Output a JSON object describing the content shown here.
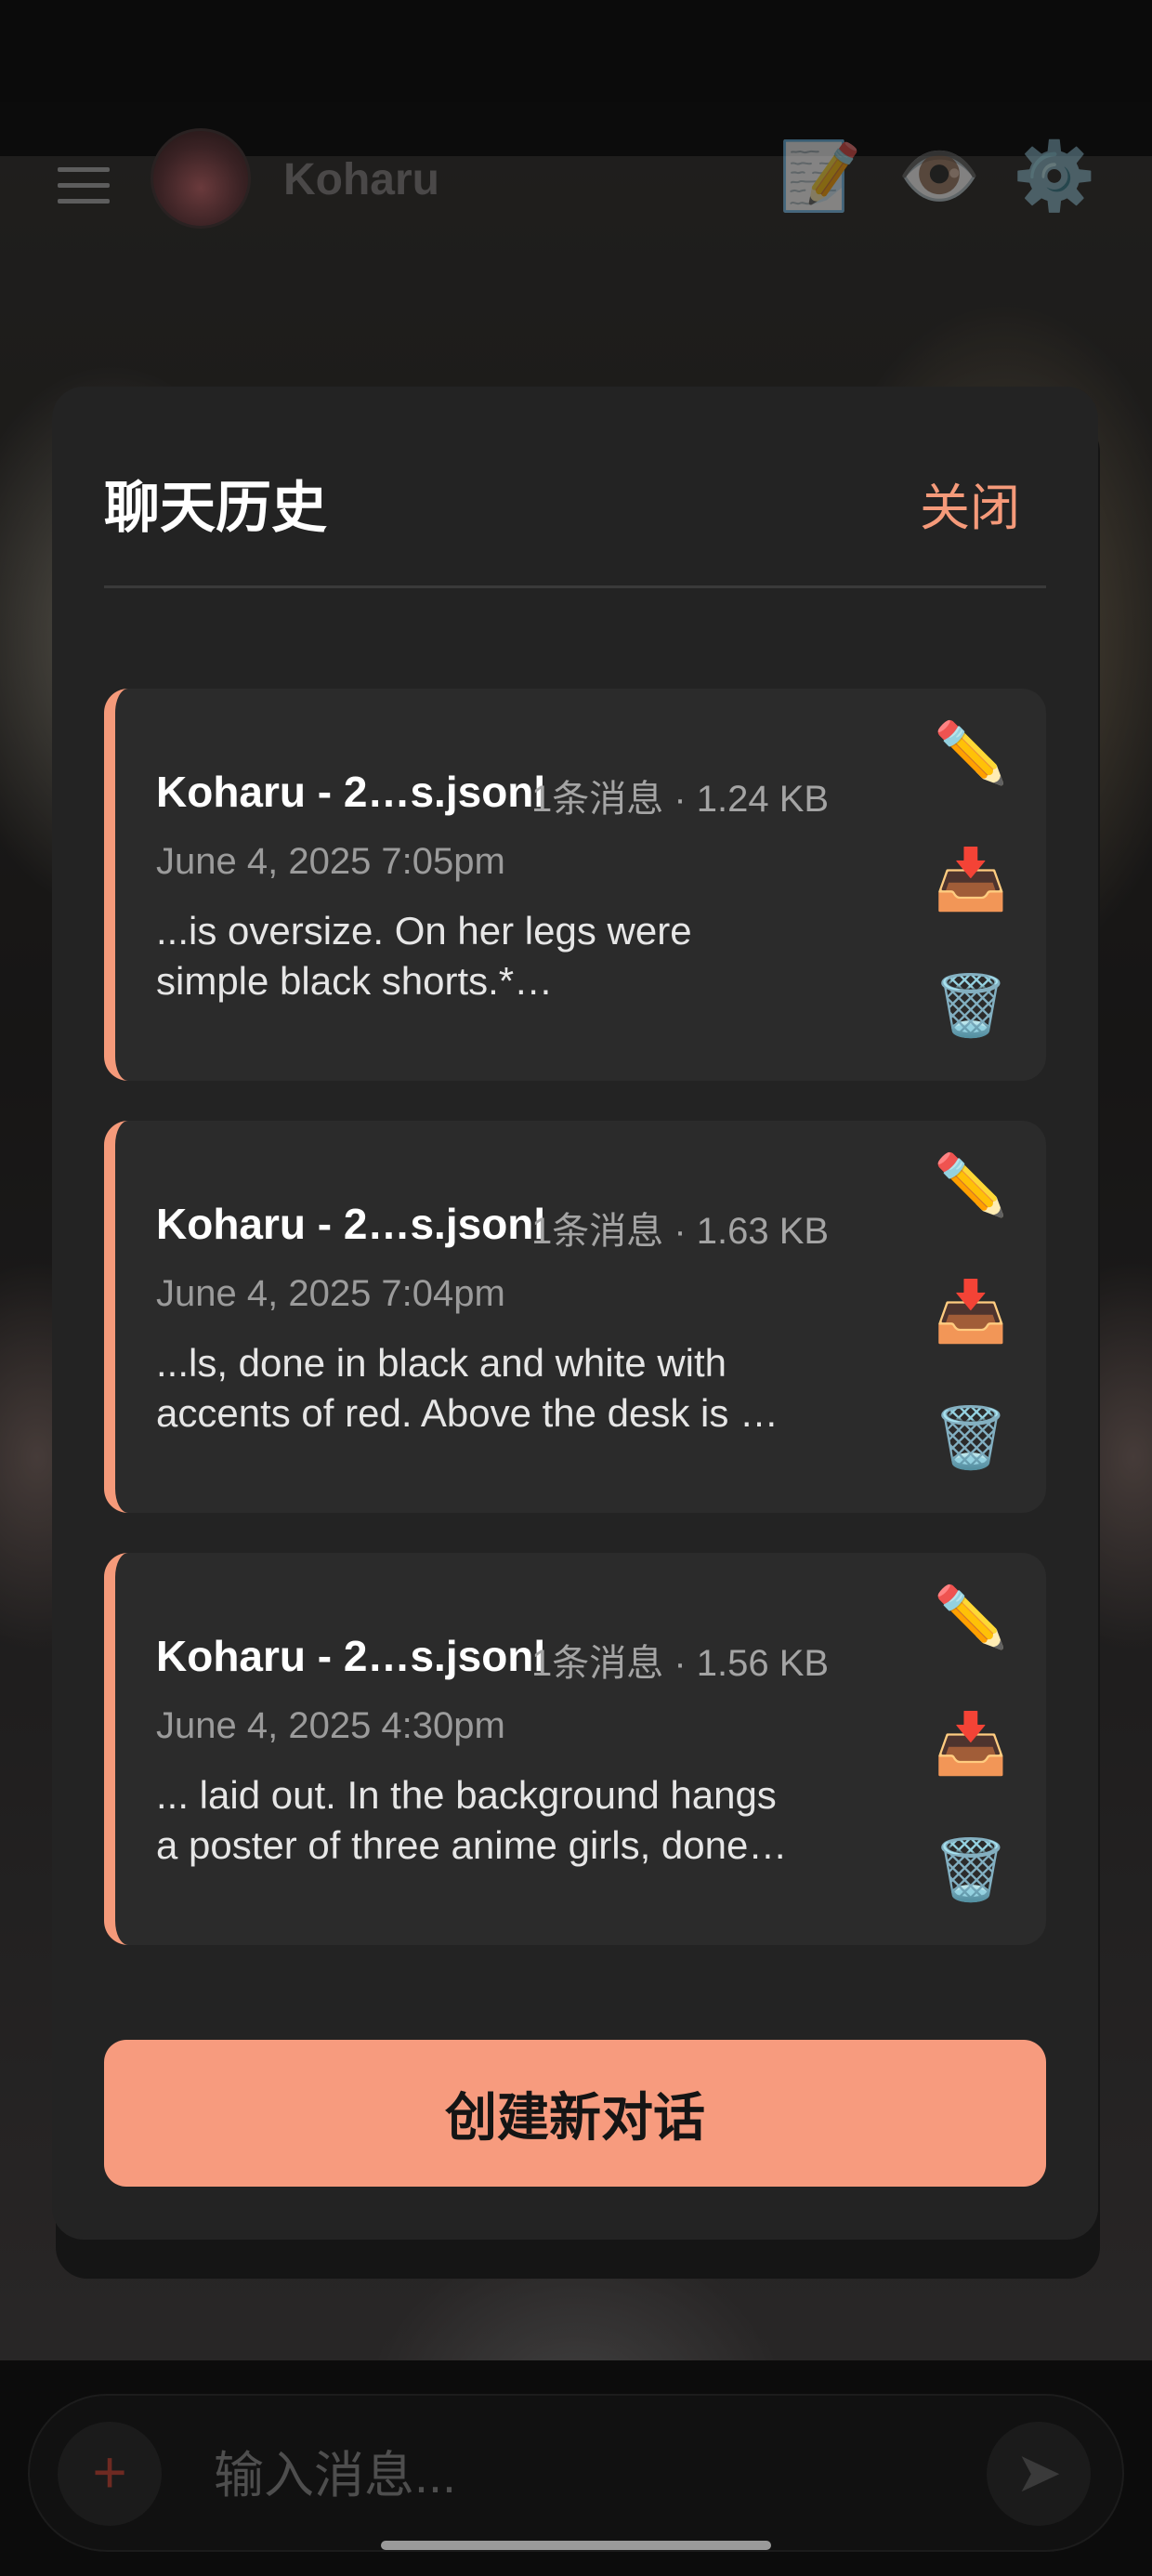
{
  "app_bar": {
    "title": "Koharu",
    "icons": [
      "menu-icon",
      "avatar",
      "memo-icon",
      "eye-icon",
      "gear-icon"
    ]
  },
  "modal": {
    "title": "聊天历史",
    "close_label": "关闭",
    "new_chat_label": "创建新对话",
    "sessions": [
      {
        "title": "Koharu - 2…s.jsonl",
        "meta": "1条消息 · 1.24 KB",
        "date": "June 4, 2025 7:05pm",
        "preview_line1": "...is oversize. On her legs were",
        "preview_line2": "simple black shorts.*…"
      },
      {
        "title": "Koharu - 2…s.jsonl",
        "meta": "1条消息 · 1.63 KB",
        "date": "June 4, 2025 7:04pm",
        "preview_line1": "...ls, done in black and white with",
        "preview_line2": "accents of red. Above the desk is …"
      },
      {
        "title": "Koharu - 2…s.jsonl",
        "meta": "1条消息 · 1.56 KB",
        "date": "June 4, 2025 4:30pm",
        "preview_line1": "... laid out. In the background hangs",
        "preview_line2": "a poster of three anime girls, done…"
      }
    ],
    "action_icons": {
      "edit": "✏️",
      "download": "📥",
      "delete": "🗑️"
    }
  },
  "input_bar": {
    "placeholder": "输入消息...",
    "plus_glyph": "+",
    "send_glyph": "➤"
  },
  "colors": {
    "accent": "#f59a7a",
    "modal_bg": "#232323",
    "card_bg": "#2b2b2b"
  }
}
